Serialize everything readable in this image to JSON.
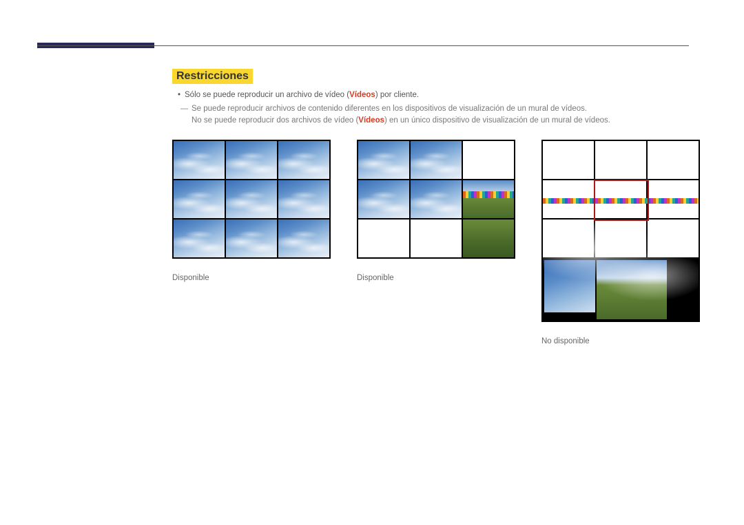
{
  "section_title": "Restricciones",
  "bullet_text_pre": "Sólo se puede reproducir un archivo de vídeo (",
  "bullet_text_hl": "Vídeos",
  "bullet_text_post": ") por cliente.",
  "subnote_line1": "Se puede reproducir archivos de contenido diferentes en los dispositivos de visualización de un mural de vídeos.",
  "subnote_line2_pre": "No se puede reproducir dos archivos de vídeo (",
  "subnote_line2_hl": "Vídeos",
  "subnote_line2_post": ") en un único dispositivo de visualización de un mural de vídeos.",
  "captions": {
    "c1": "Disponible",
    "c2": "Disponible",
    "c3": "No disponible"
  }
}
